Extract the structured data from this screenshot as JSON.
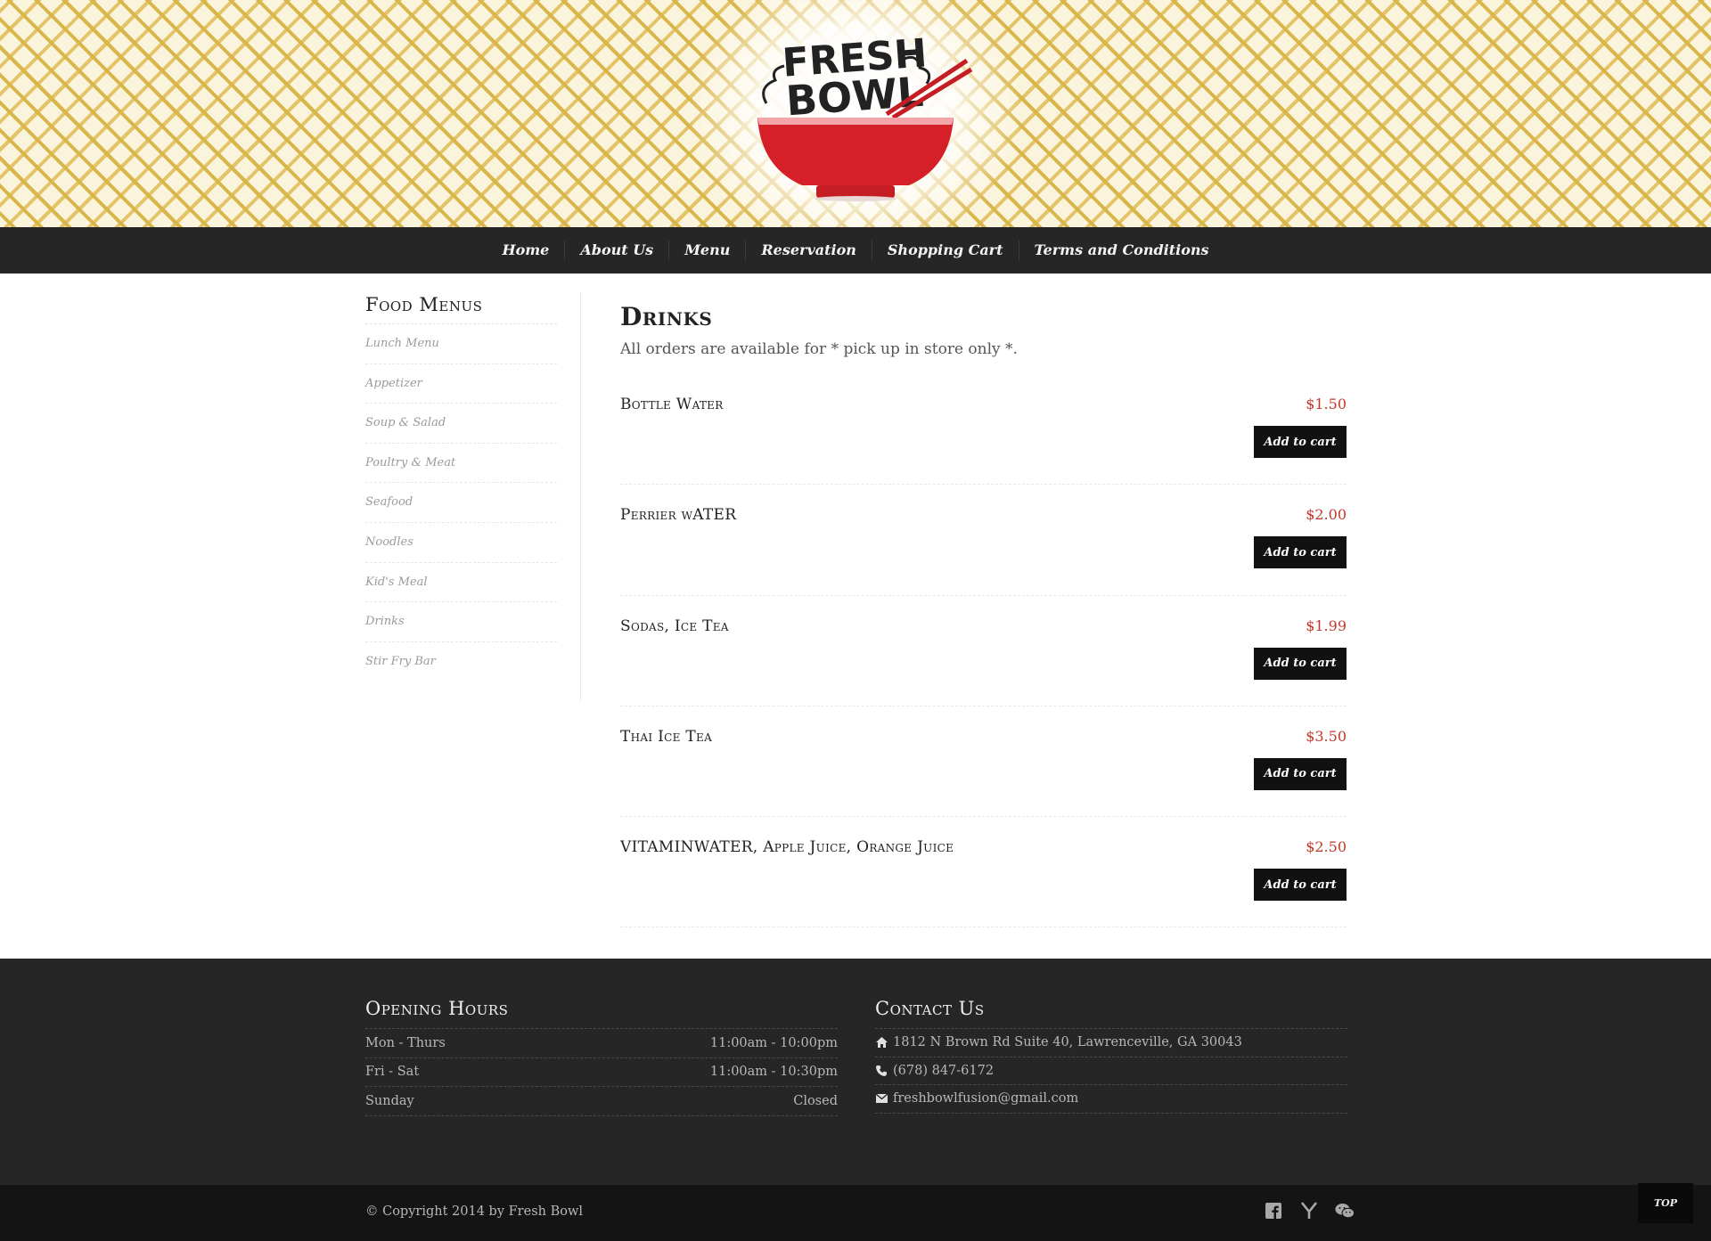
{
  "brand": {
    "logo_line1": "FRESH",
    "logo_line2": "BOWL",
    "bowl_color": "#d42026"
  },
  "nav": {
    "items": [
      "Home",
      "About Us",
      "Menu",
      "Reservation",
      "Shopping Cart",
      "Terms and Conditions"
    ]
  },
  "sidebar": {
    "title": "Food Menus",
    "items": [
      "Lunch Menu",
      "Appetizer",
      "Soup & Salad",
      "Poultry & Meat",
      "Seafood",
      "Noodles",
      "Kid's Meal",
      "Drinks",
      "Stir Fry Bar"
    ]
  },
  "main": {
    "title": "Drinks",
    "notice": "All orders are available for * pick up in store only *.",
    "button_label": "Add to cart",
    "items": [
      {
        "name": "Bottle Water",
        "price": "$1.50"
      },
      {
        "name": "Perrier wATER",
        "price": "$2.00"
      },
      {
        "name": "Sodas, Ice Tea",
        "price": "$1.99"
      },
      {
        "name": "Thai Ice Tea",
        "price": "$3.50"
      },
      {
        "name": "VITAMINWATER, Apple Juice, Orange Juice",
        "price": "$2.50"
      }
    ]
  },
  "footer": {
    "hours": {
      "title": "Opening Hours",
      "rows": [
        {
          "days": "Mon - Thurs",
          "time": "11:00am - 10:00pm"
        },
        {
          "days": "Fri - Sat",
          "time": "11:00am - 10:30pm"
        },
        {
          "days": "Sunday",
          "time": "Closed"
        }
      ]
    },
    "contact": {
      "title": "Contact Us",
      "address": "1812 N Brown Rd Suite 40, Lawrenceville, GA 30043",
      "phone": "(678) 847-6172",
      "email": "freshbowlfusion@gmail.com"
    }
  },
  "bottom": {
    "copyright": "© Copyright 2014 by Fresh Bowl",
    "social_icons": [
      "facebook-icon",
      "yelp-icon",
      "wechat-icon"
    ],
    "top_label": "TOP"
  },
  "colors": {
    "accent_price": "#c0392b",
    "nav_bg": "#262626",
    "footer_bg": "#262626",
    "bottom_bg": "#141414",
    "pattern_gold": "#d9b64a"
  }
}
